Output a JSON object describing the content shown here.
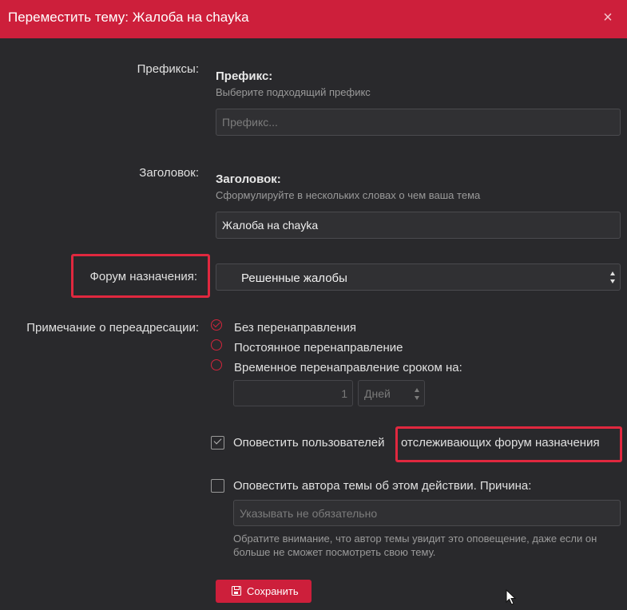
{
  "dialog": {
    "title": "Переместить тему: Жалоба на chayka",
    "close_symbol": "×"
  },
  "prefix": {
    "label": "Префиксы:",
    "heading": "Префикс:",
    "hint": "Выберите подходящий префикс",
    "placeholder": "Префикс..."
  },
  "thread_title": {
    "label": "Заголовок:",
    "heading": "Заголовок:",
    "hint": "Сформулируйте в нескольких словах о чем ваша тема",
    "value": "Жалоба на chayka"
  },
  "forum": {
    "label": "Форум назначения:",
    "selected": "Решенные жалобы"
  },
  "redirect": {
    "label": "Примечание о переадресации:",
    "options": [
      {
        "label": "Без перенаправления",
        "selected": true
      },
      {
        "label": "Постоянное перенаправление",
        "selected": false
      },
      {
        "label": "Временное перенаправление сроком на:",
        "selected": false
      }
    ],
    "duration_value": "1",
    "duration_unit": "Дней"
  },
  "notify_watchers": {
    "label_part1": "Оповестить пользователей",
    "label_part2": "отслеживающих форум назначения",
    "checked": true
  },
  "notify_author": {
    "label": "Оповестить автора темы об этом действии. Причина:",
    "checked": false,
    "placeholder": "Указывать не обязательно",
    "note": "Обратите внимание, что автор темы увидит это оповещение, даже если он больше не сможет посмотреть свою тему."
  },
  "save_button": {
    "label": "Сохранить"
  },
  "colors": {
    "accent": "#cd1f3b",
    "highlight": "#e0283f",
    "background": "#29292c"
  }
}
